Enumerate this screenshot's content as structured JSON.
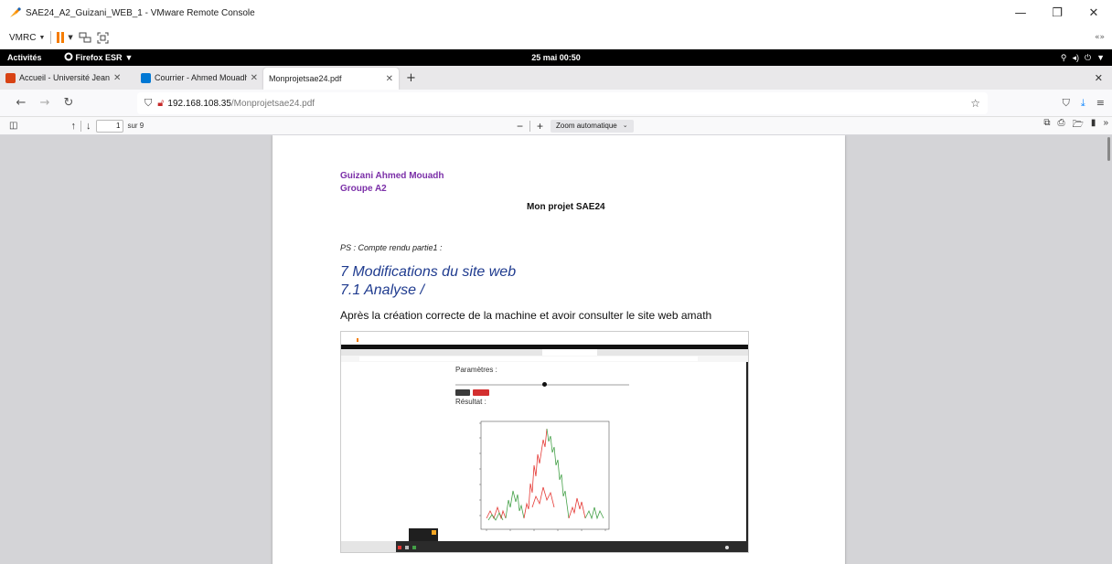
{
  "window": {
    "title": "SAE24_A2_Guizani_WEB_1 - VMware Remote Console",
    "minimize_glyph": "—",
    "maximize_glyph": "❐",
    "close_glyph": "✕"
  },
  "vmrc": {
    "menu_label": "VMRC",
    "right_glyph": "«»"
  },
  "gnome": {
    "activities": "Activités",
    "app_menu": "Firefox ESR",
    "clock": "25 mai  00:50"
  },
  "tabs": [
    {
      "label": "Accueil - Université Jean",
      "favicon_color": "#d84315"
    },
    {
      "label": "Courrier - Ahmed Mouadh",
      "favicon_color": "#0078d4"
    },
    {
      "label": "Monprojetsae24.pdf",
      "favicon_color": "#ffffff"
    }
  ],
  "url": {
    "host": "192.168.108.35",
    "path": "/Monprojetsae24.pdf"
  },
  "pdf_toolbar": {
    "page_number": "1",
    "page_of": "sur 9",
    "zoom": "Zoom automatique"
  },
  "document": {
    "author": "Guizani Ahmed Mouadh",
    "group": "Groupe A2",
    "title": "Mon projet SAE24",
    "ps_note": "PS : Compte rendu partie1 :",
    "heading_1": "7 Modifications du site web",
    "heading_2": "7.1 Analyse /",
    "body_text": "Après la création correcte de la machine et  avoir consulter le site web amath"
  },
  "embedded": {
    "params_label": "Paramètres :",
    "result_label": "Résultat :"
  },
  "colors": {
    "accent_author": "#7b2fa8",
    "heading_blue": "#1f3b8f",
    "pause_orange": "#f57c00",
    "url_lock_red": "#c62828"
  }
}
